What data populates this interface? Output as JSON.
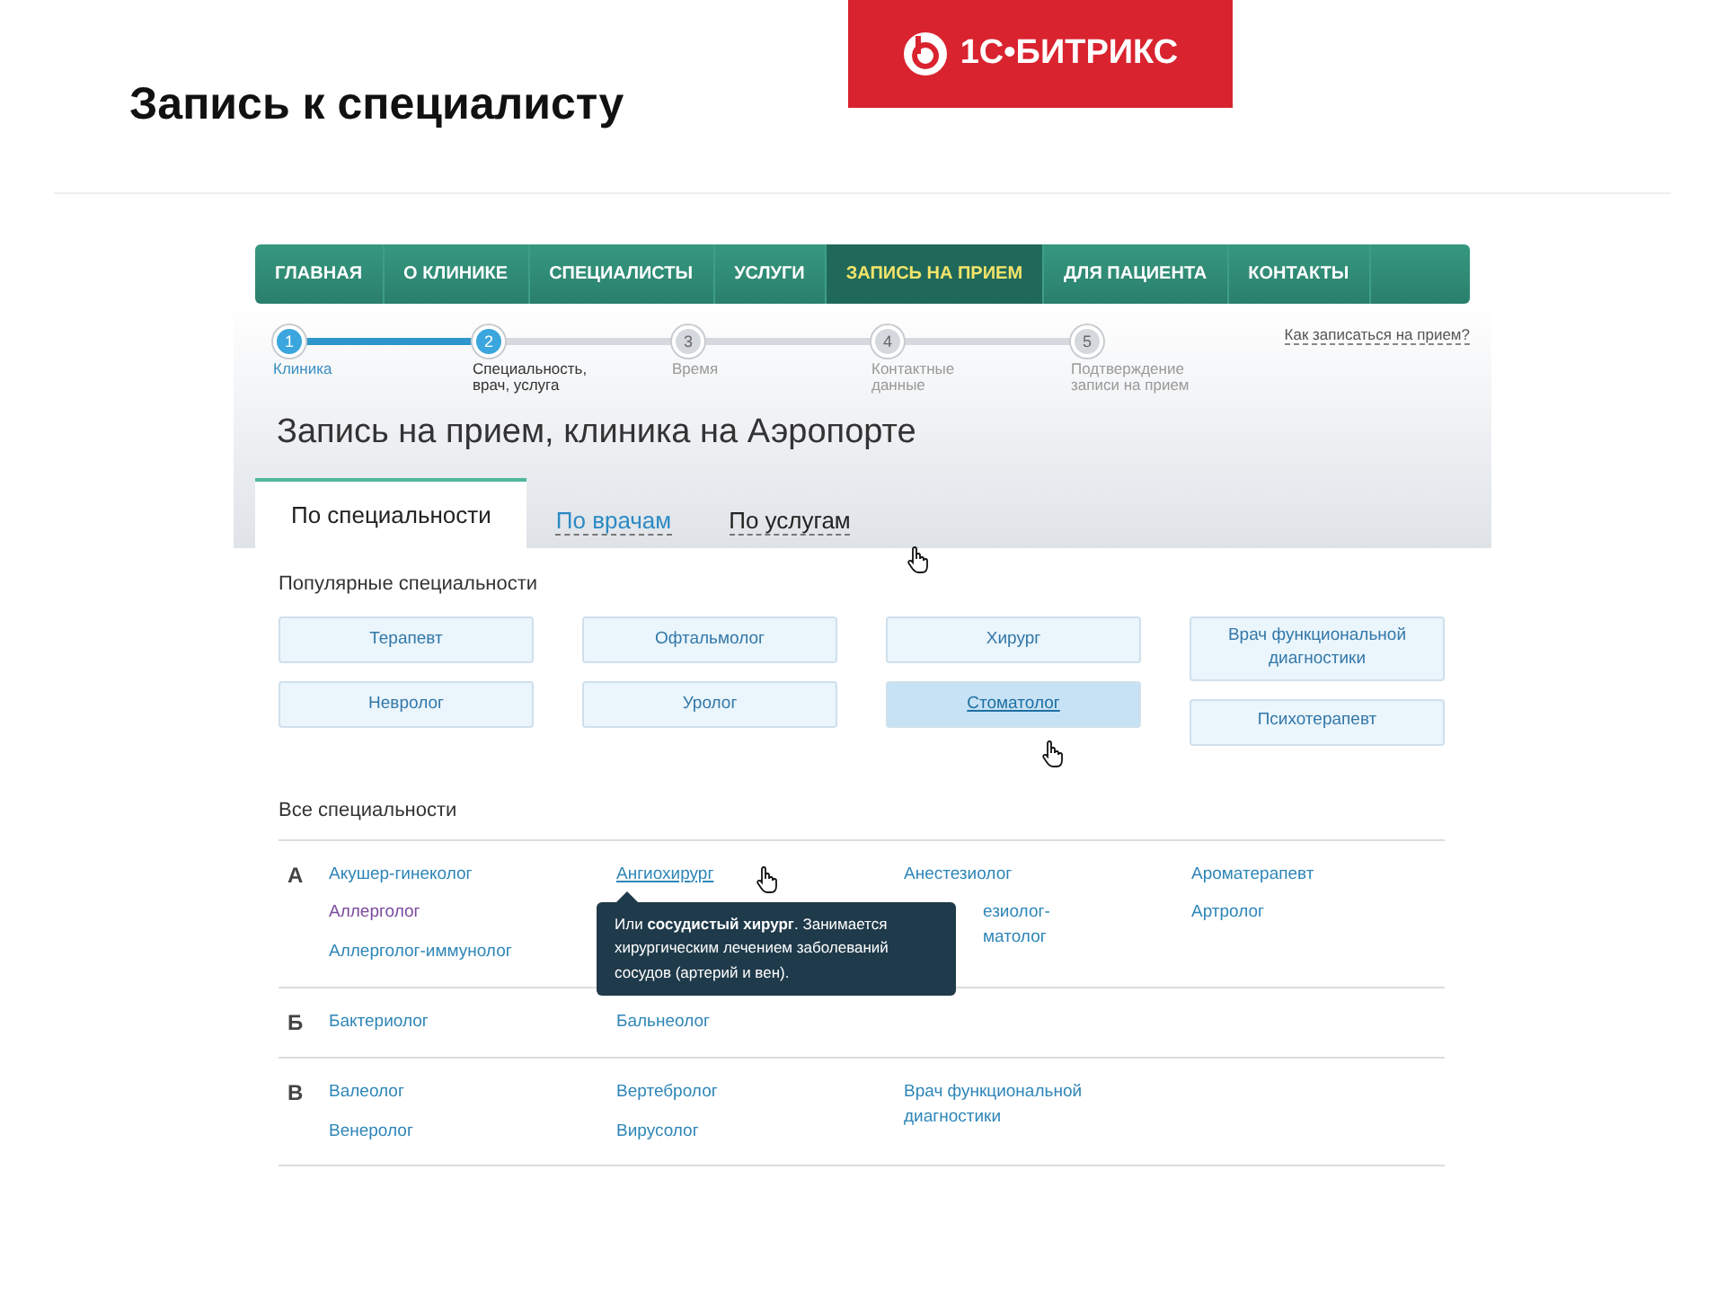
{
  "slide": {
    "title": "Запись к специалисту",
    "logo": "1С•БИТРИКС"
  },
  "nav": [
    {
      "label": "ГЛАВНАЯ",
      "selected": false
    },
    {
      "label": "О КЛИНИКЕ",
      "selected": false
    },
    {
      "label": "СПЕЦИАЛИСТЫ",
      "selected": false
    },
    {
      "label": "УСЛУГИ",
      "selected": false
    },
    {
      "label": "ЗАПИСЬ НА ПРИЕМ",
      "selected": true
    },
    {
      "label": "ДЛЯ ПАЦИЕНТА",
      "selected": false
    },
    {
      "label": "КОНТАКТЫ",
      "selected": false
    }
  ],
  "steps": [
    {
      "number": "1",
      "label": "Клиника",
      "completed": true,
      "current": false
    },
    {
      "number": "2",
      "label": "Специальность,\nврач, услуга",
      "completed": false,
      "current": true
    },
    {
      "number": "3",
      "label": "Время",
      "completed": false,
      "current": false
    },
    {
      "number": "4",
      "label": "Контактные\nданные",
      "completed": false,
      "current": false
    },
    {
      "number": "5",
      "label": "Подтверждение\nзаписи на прием",
      "completed": false,
      "current": false
    }
  ],
  "help_link": "Как записаться на прием?",
  "page_title": "Запись на прием, клиника на Аэропорте",
  "tabs": [
    {
      "label": "По специальности",
      "selected": true
    },
    {
      "label": "По врачам",
      "selected": false
    },
    {
      "label": "По услугам",
      "selected": false
    }
  ],
  "popular": {
    "heading": "Популярные специальности",
    "columns": [
      [
        {
          "label": "Терапевт",
          "selected": false
        },
        {
          "label": "Невролог",
          "selected": false
        }
      ],
      [
        {
          "label": "Офтальмолог",
          "selected": false
        },
        {
          "label": "Уролог",
          "selected": false
        }
      ],
      [
        {
          "label": "Хирург",
          "selected": false
        },
        {
          "label": "Стоматолог",
          "selected": true
        }
      ],
      [
        {
          "label": "Врач функциональной диагностики",
          "selected": false
        },
        {
          "label": "Психотерапевт",
          "selected": false
        }
      ]
    ]
  },
  "all": {
    "heading": "Все специальности",
    "groups": [
      {
        "letter": "А",
        "columns": [
          [
            {
              "label": "Акушер-гинеколог",
              "visited": false
            },
            {
              "label": "Аллерголог",
              "visited": true
            },
            {
              "label": "Аллерголог-иммунолог",
              "visited": false
            }
          ],
          [
            {
              "label": "Ангиохирург",
              "visited": false,
              "hovered": true
            }
          ],
          [
            {
              "label": "Анестезиолог",
              "visited": false
            },
            {
              "label": "езиолог-\nматолог",
              "visited": false,
              "clipped": true
            }
          ],
          [
            {
              "label": "Ароматерапевт",
              "visited": false
            },
            {
              "label": "Артролог",
              "visited": false
            }
          ]
        ],
        "tooltip": "Или **сосудистый хирург**. Занимается хирургическим лечением заболеваний сосудов (артерий и вен)."
      },
      {
        "letter": "Б",
        "columns": [
          [
            {
              "label": "Бактериолог",
              "visited": false
            }
          ],
          [
            {
              "label": "Бальнеолог",
              "visited": false
            }
          ],
          [],
          []
        ]
      },
      {
        "letter": "В",
        "columns": [
          [
            {
              "label": "Валеолог",
              "visited": false
            },
            {
              "label": "Венеролог",
              "visited": false
            }
          ],
          [
            {
              "label": "Вертебролог",
              "visited": false
            },
            {
              "label": "Вирусолог",
              "visited": false
            }
          ],
          [
            {
              "label": "Врач функциональной\nдиагностики",
              "visited": false
            }
          ],
          []
        ]
      }
    ]
  }
}
